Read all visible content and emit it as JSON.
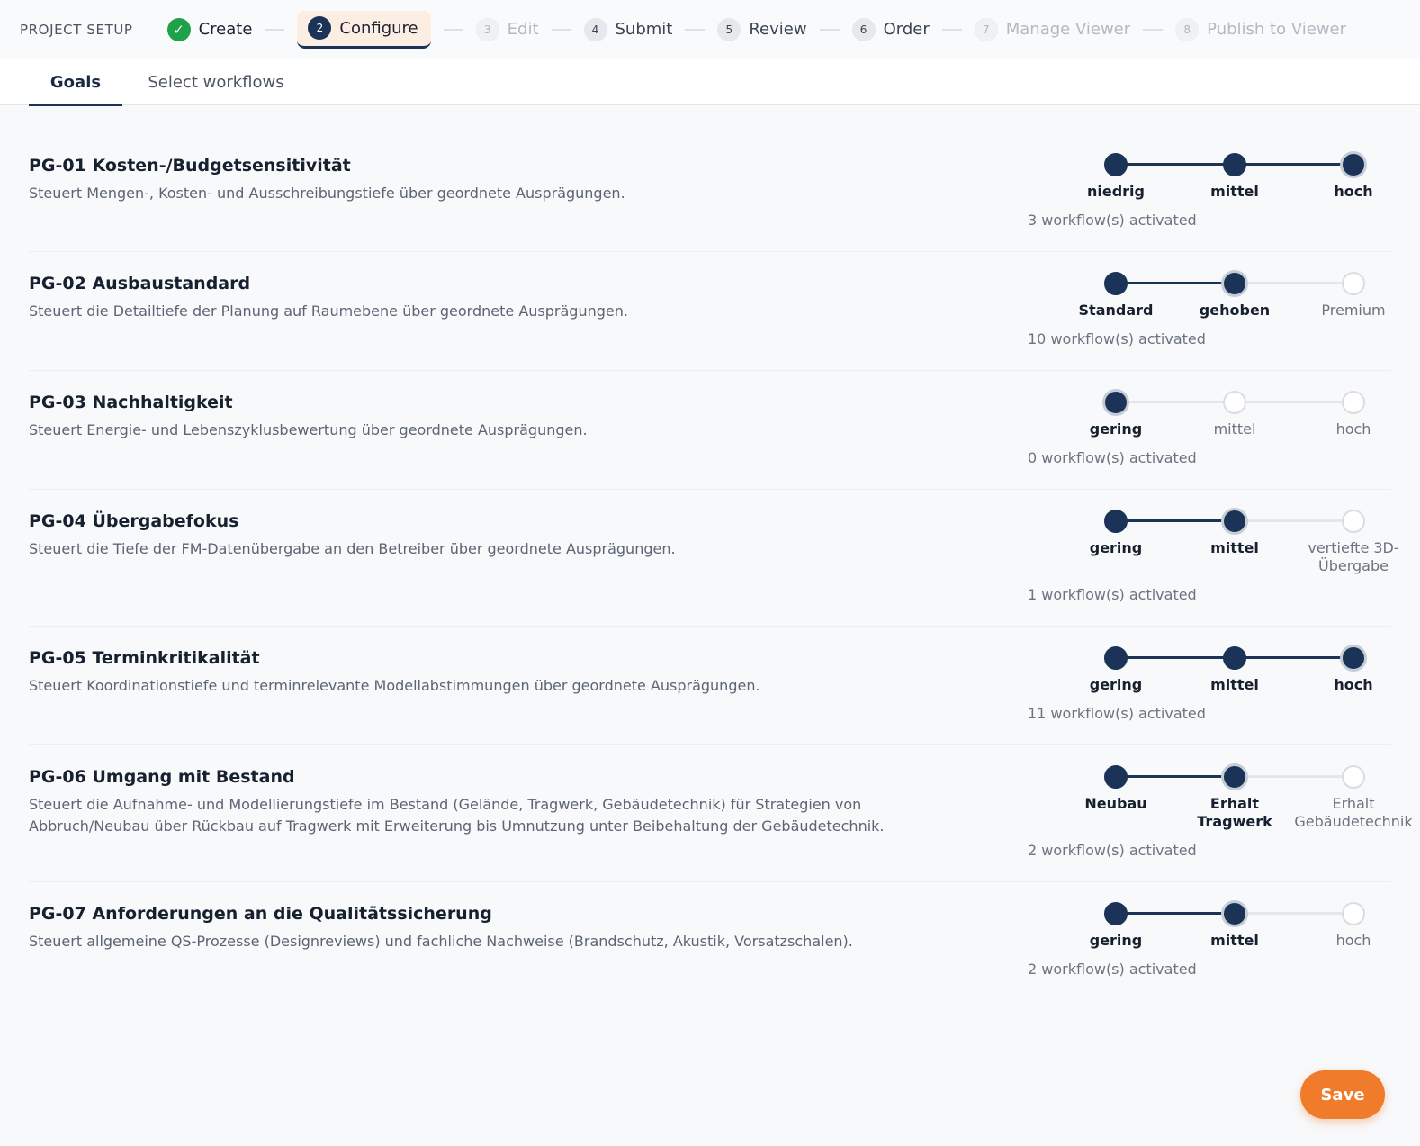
{
  "header": {
    "title": "PROJECT SETUP",
    "steps": [
      {
        "number": "✓",
        "label": "Create",
        "state": "done"
      },
      {
        "number": "2",
        "label": "Configure",
        "state": "active"
      },
      {
        "number": "3",
        "label": "Edit",
        "state": "disabled"
      },
      {
        "number": "4",
        "label": "Submit",
        "state": "enabled"
      },
      {
        "number": "5",
        "label": "Review",
        "state": "enabled"
      },
      {
        "number": "6",
        "label": "Order",
        "state": "enabled"
      },
      {
        "number": "7",
        "label": "Manage Viewer",
        "state": "disabled"
      },
      {
        "number": "8",
        "label": "Publish to Viewer",
        "state": "disabled"
      }
    ]
  },
  "tabs": [
    {
      "label": "Goals",
      "active": true
    },
    {
      "label": "Select workflows",
      "active": false
    }
  ],
  "goals": [
    {
      "title": "PG-01 Kosten-/Budgetsensitivität",
      "description": "Steuert Mengen-, Kosten- und Ausschreibungstiefe über geordnete Ausprägungen.",
      "options": [
        "niedrig",
        "mittel",
        "hoch"
      ],
      "selected_index": 2,
      "count": "3 workflow(s) activated"
    },
    {
      "title": "PG-02 Ausbaustandard",
      "description": "Steuert die Detailtiefe der Planung auf Raumebene über geordnete Ausprägungen.",
      "options": [
        "Standard",
        "gehoben",
        "Premium"
      ],
      "selected_index": 1,
      "count": "10 workflow(s) activated"
    },
    {
      "title": "PG-03 Nachhaltigkeit",
      "description": "Steuert Energie- und Lebenszyklusbewertung über geordnete Ausprägungen.",
      "options": [
        "gering",
        "mittel",
        "hoch"
      ],
      "selected_index": 0,
      "count": "0 workflow(s) activated"
    },
    {
      "title": "PG-04 Übergabefokus",
      "description": "Steuert die Tiefe der FM-Datenübergabe an den Betreiber über geordnete Ausprägungen.",
      "options": [
        "gering",
        "mittel",
        "vertiefte 3D-Übergabe"
      ],
      "selected_index": 1,
      "count": "1 workflow(s) activated"
    },
    {
      "title": "PG-05 Terminkritikalität",
      "description": "Steuert Koordinationstiefe und terminrelevante Modellabstimmungen über geordnete Ausprägungen.",
      "options": [
        "gering",
        "mittel",
        "hoch"
      ],
      "selected_index": 2,
      "count": "11 workflow(s) activated"
    },
    {
      "title": "PG-06 Umgang mit Bestand",
      "description": "Steuert die Aufnahme- und Modellierungstiefe im Bestand (Gelände, Tragwerk, Gebäudetechnik) für Strategien von Abbruch/Neubau über Rückbau auf Tragwerk mit Erweiterung bis Umnutzung unter Beibehaltung der Gebäudetechnik.",
      "options": [
        "Neubau",
        "Erhalt Tragwerk",
        "Erhalt Gebäudetechnik"
      ],
      "selected_index": 1,
      "count": "2 workflow(s) activated"
    },
    {
      "title": "PG-07 Anforderungen an die Qualitätssicherung",
      "description": "Steuert allgemeine QS-Prozesse (Designreviews) und fachliche Nachweise (Brandschutz, Akustik, Vorsatzschalen).",
      "options": [
        "gering",
        "mittel",
        "hoch"
      ],
      "selected_index": 1,
      "count": "2 workflow(s) activated"
    }
  ],
  "actions": {
    "save_label": "Save"
  },
  "colors": {
    "accent": "#1b3357",
    "save": "#f07b2a",
    "done": "#1fa149"
  }
}
